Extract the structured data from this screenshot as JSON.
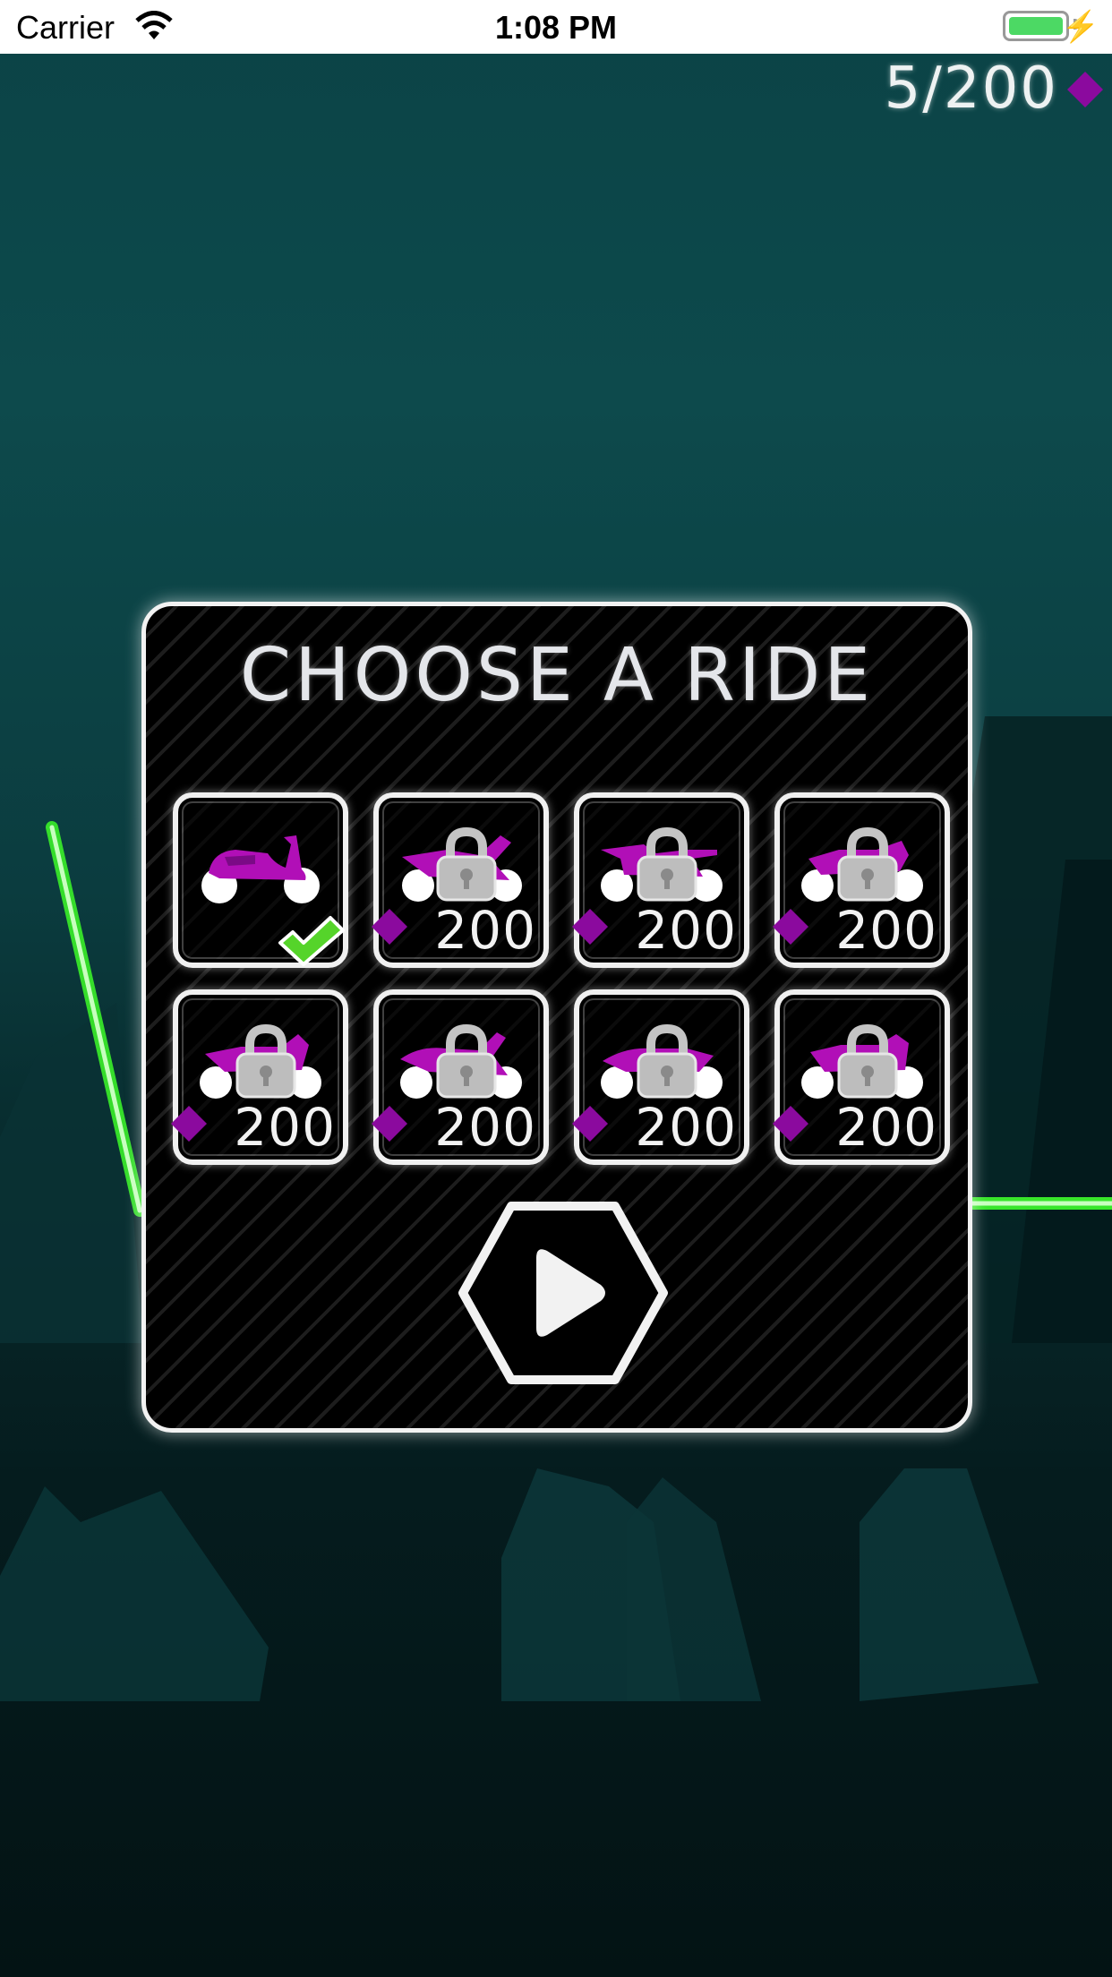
{
  "status_bar": {
    "carrier": "Carrier",
    "time": "1:08 PM"
  },
  "hud": {
    "gems": "5/200",
    "gem_icon": "purple-diamond-icon"
  },
  "panel": {
    "title": "CHOOSE A RIDE"
  },
  "rides": [
    {
      "price": "",
      "locked": false,
      "selected": true
    },
    {
      "price": "200",
      "locked": true,
      "selected": false
    },
    {
      "price": "200",
      "locked": true,
      "selected": false
    },
    {
      "price": "200",
      "locked": true,
      "selected": false
    },
    {
      "price": "200",
      "locked": true,
      "selected": false
    },
    {
      "price": "200",
      "locked": true,
      "selected": false
    },
    {
      "price": "200",
      "locked": true,
      "selected": false
    },
    {
      "price": "200",
      "locked": true,
      "selected": false
    }
  ],
  "colors": {
    "gem": "#8b0a9e",
    "bike": "#b10fb7",
    "line": "#38e62a",
    "check": "#55d42a"
  },
  "play_button": {
    "icon": "play-icon"
  }
}
